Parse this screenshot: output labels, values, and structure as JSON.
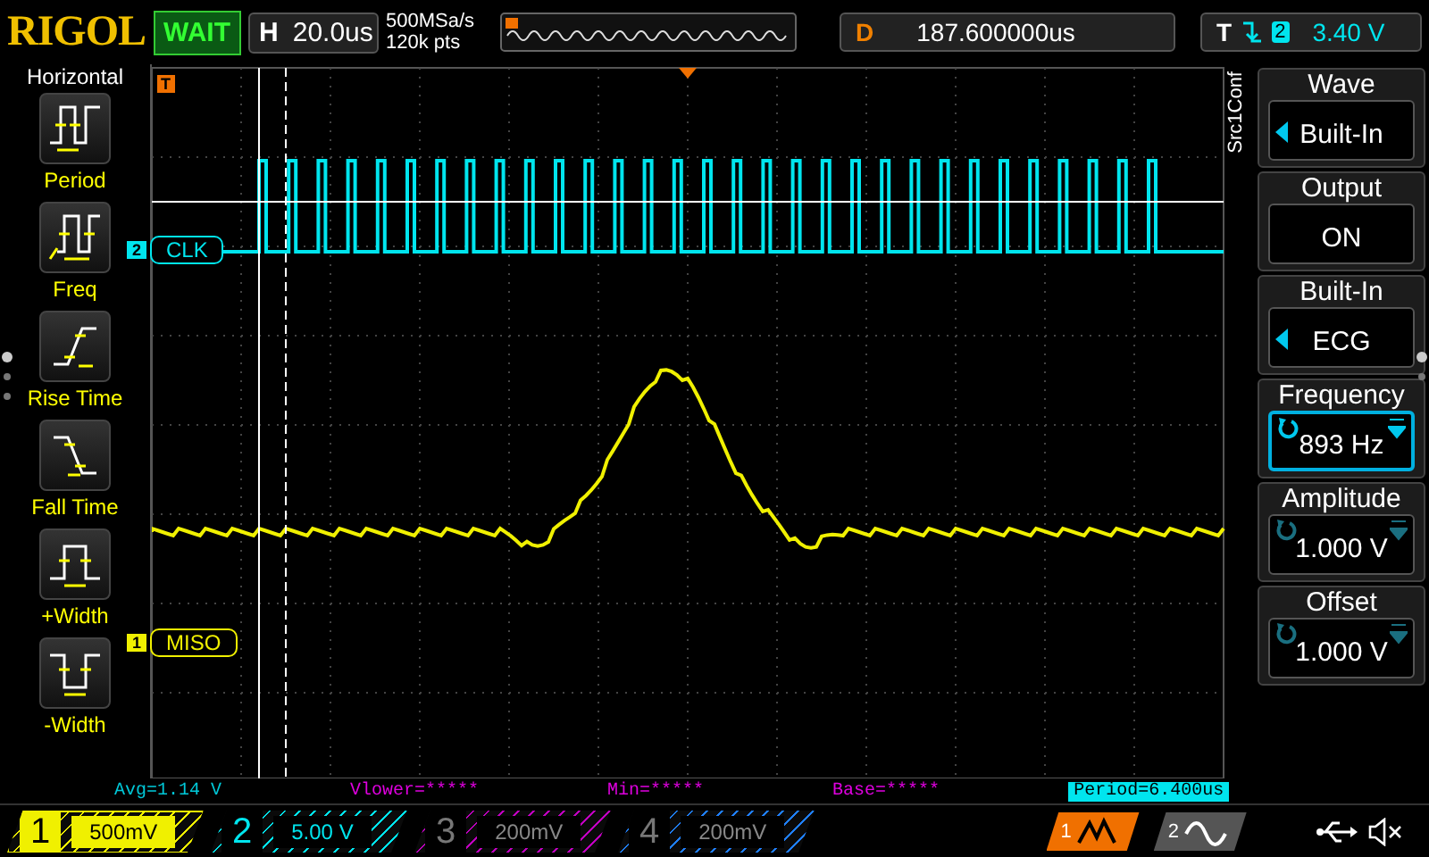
{
  "top_bar": {
    "brand": "RIGOL",
    "run_status": "WAIT",
    "horizontal": {
      "label": "H",
      "value": "20.0us"
    },
    "sample_rate": "500MSa/s",
    "memory_depth": "120k pts",
    "delay": {
      "label": "D",
      "value": "187.600000us"
    },
    "trigger": {
      "label": "T",
      "source": "2",
      "level": "3.40 V"
    }
  },
  "left_menu": {
    "title": "Horizontal",
    "items": [
      {
        "label": "Period",
        "kind": "period"
      },
      {
        "label": "Freq",
        "kind": "freq"
      },
      {
        "label": "Rise Time",
        "kind": "rise"
      },
      {
        "label": "Fall Time",
        "kind": "fall"
      },
      {
        "label": "+Width",
        "kind": "pwidth"
      },
      {
        "label": "-Width",
        "kind": "nwidth"
      }
    ]
  },
  "grid": {
    "trigger_marker": "T",
    "channel_labels": [
      {
        "channel": "2",
        "label": "CLK",
        "color": "#00e5ee"
      },
      {
        "channel": "1",
        "label": "MISO",
        "color": "#f0f000"
      }
    ]
  },
  "measurements": [
    {
      "text": "Avg=1.14 V",
      "color": "#00c8d8",
      "selected": false
    },
    {
      "text": "Vlower=*****",
      "color": "#e000e0",
      "selected": false
    },
    {
      "text": "Min=*****",
      "color": "#e000e0",
      "selected": false
    },
    {
      "text": "Base=*****",
      "color": "#e000e0",
      "selected": false
    },
    {
      "text": "Period=6.400us",
      "color": "#00e5ee",
      "selected": true
    }
  ],
  "right_menu": {
    "title": "Src1Conf",
    "items": [
      {
        "title": "Wave",
        "value": "Built-In",
        "kind": "arrow",
        "selected": false
      },
      {
        "title": "Output",
        "value": "ON",
        "kind": "plain",
        "selected": false
      },
      {
        "title": "Built-In",
        "value": "ECG",
        "kind": "arrow",
        "selected": false
      },
      {
        "title": "Frequency",
        "value": "893 Hz",
        "kind": "knob",
        "selected": true
      },
      {
        "title": "Amplitude",
        "value": "1.000 V",
        "kind": "knob",
        "selected": false
      },
      {
        "title": "Offset",
        "value": "1.000 V",
        "kind": "knob",
        "selected": false
      }
    ]
  },
  "channels": [
    {
      "number": "1",
      "scale": "500mV",
      "color": "#f0f000",
      "on": true
    },
    {
      "number": "2",
      "scale": "5.00 V",
      "color": "#00e5ee",
      "on": true
    },
    {
      "number": "3",
      "scale": "200mV",
      "color": "#c000c0",
      "on": false
    },
    {
      "number": "4",
      "scale": "200mV",
      "color": "#2080ff",
      "on": false
    }
  ],
  "generators": [
    {
      "number": "1",
      "on": true
    },
    {
      "number": "2",
      "on": false
    }
  ]
}
